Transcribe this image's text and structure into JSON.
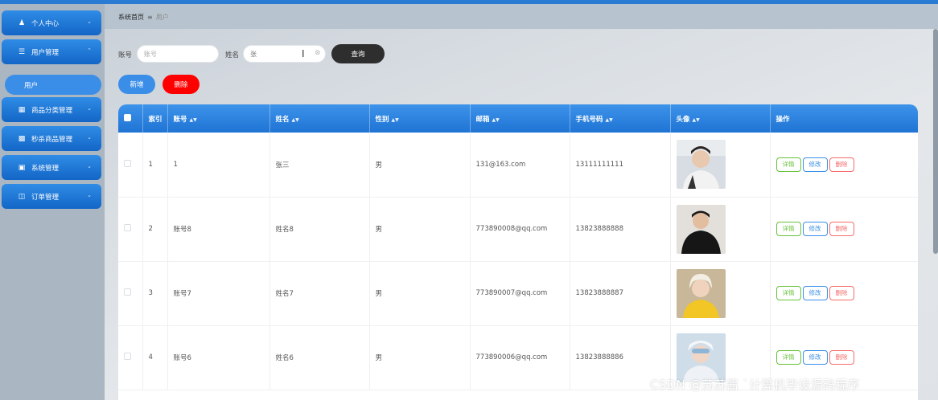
{
  "breadcrumb": {
    "home": "系统首页",
    "current": "用户"
  },
  "sidebar": {
    "items": [
      {
        "label": "个人中心",
        "icon": "person-icon"
      },
      {
        "label": "用户管理",
        "icon": "list-icon"
      },
      {
        "label": "商品分类管理",
        "icon": "grid-icon"
      },
      {
        "label": "秒杀商品管理",
        "icon": "apps-icon"
      },
      {
        "label": "系统管理",
        "icon": "monitor-icon"
      },
      {
        "label": "订单管理",
        "icon": "clipboard-icon"
      }
    ],
    "active_sub": "用户"
  },
  "search": {
    "account_label": "账号",
    "account_placeholder": "账号",
    "name_label": "姓名",
    "name_value": "张",
    "query_button": "查询"
  },
  "actions": {
    "add": "新增",
    "delete": "删除"
  },
  "table": {
    "headers": [
      "",
      "索引",
      "账号",
      "姓名",
      "性别",
      "邮箱",
      "手机号码",
      "头像",
      "操作"
    ],
    "sortable_flags": [
      "",
      "",
      "sort",
      "sort",
      "sort",
      "sort",
      "sort",
      "sort",
      ""
    ],
    "rows": [
      {
        "index": "1",
        "account": "1",
        "name": "张三",
        "gender": "男",
        "email": "131@163.com",
        "phone": "13111111111"
      },
      {
        "index": "2",
        "account": "账号8",
        "name": "姓名8",
        "gender": "男",
        "email": "773890008@qq.com",
        "phone": "13823888888"
      },
      {
        "index": "3",
        "account": "账号7",
        "name": "姓名7",
        "gender": "男",
        "email": "773890007@qq.com",
        "phone": "13823888887"
      },
      {
        "index": "4",
        "account": "账号6",
        "name": "姓名6",
        "gender": "男",
        "email": "773890006@qq.com",
        "phone": "13823888886"
      }
    ],
    "op_labels": {
      "detail": "详情",
      "edit": "修改",
      "remove": "删除"
    }
  },
  "watermark": "CSDN @苏苏酱  `计算机毕设源码程序",
  "colors": {
    "primary": "#2a7bd4",
    "danger": "#ff0000",
    "dark_button": "#2e2e2e"
  }
}
